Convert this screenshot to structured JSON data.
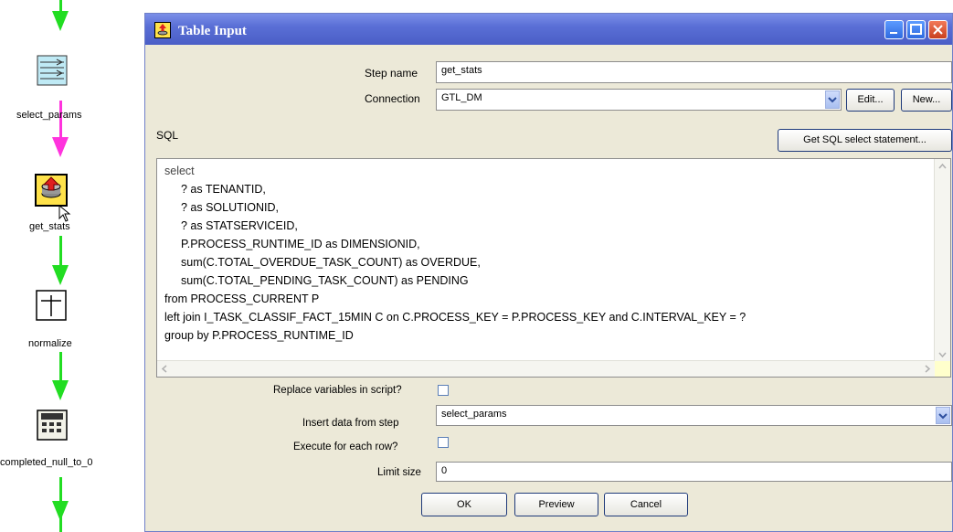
{
  "canvas": {
    "steps": [
      {
        "label": "select_params",
        "icon": "table-input-icon"
      },
      {
        "label": "get_stats",
        "icon": "table-input-db-icon"
      },
      {
        "label": "normalize",
        "icon": "normalize-icon"
      },
      {
        "label": "completed_null_to_0",
        "icon": "calculator-icon"
      }
    ]
  },
  "dialog": {
    "title": "Table Input",
    "step_name_label": "Step name",
    "step_name_value": "get_stats",
    "connection_label": "Connection",
    "connection_value": "GTL_DM",
    "edit_button": "Edit...",
    "new_button": "New...",
    "sql_label": "SQL",
    "get_sql_button": "Get SQL select statement...",
    "sql_lines": [
      "select",
      "? as TENANTID,",
      "? as SOLUTIONID,",
      "? as STATSERVICEID,",
      "P.PROCESS_RUNTIME_ID as DIMENSIONID,",
      "sum(C.TOTAL_OVERDUE_TASK_COUNT) as OVERDUE,",
      "sum(C.TOTAL_PENDING_TASK_COUNT) as PENDING",
      "from PROCESS_CURRENT P",
      "left join I_TASK_CLASSIF_FACT_15MIN C on C.PROCESS_KEY = P.PROCESS_KEY and C.INTERVAL_KEY = ?",
      "group by P.PROCESS_RUNTIME_ID"
    ],
    "replace_vars_label": "Replace variables in script?",
    "insert_data_label": "Insert data from step",
    "insert_data_value": "select_params",
    "execute_each_label": "Execute for each row?",
    "limit_size_label": "Limit size",
    "limit_size_value": "0",
    "ok_button": "OK",
    "preview_button": "Preview",
    "cancel_button": "Cancel"
  },
  "colors": {
    "hop_green": "#22dd22",
    "hop_pink": "#ff33dd",
    "titlebar": "#5a6fd6",
    "dialog_bg": "#ece9d8"
  }
}
